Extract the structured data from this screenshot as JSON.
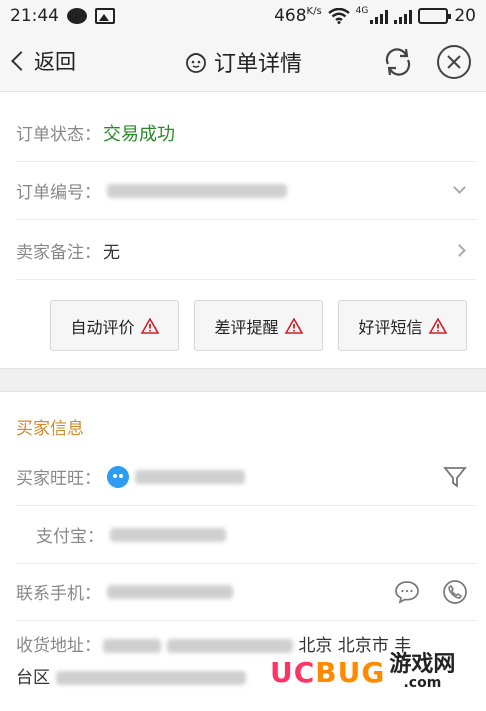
{
  "status_bar": {
    "time": "21:44",
    "speed": "468",
    "speed_unit": "K/s",
    "network": "4G",
    "battery": "20"
  },
  "header": {
    "back_label": "返回",
    "title": "订单详情"
  },
  "order": {
    "status_label": "订单状态：",
    "status_value": "交易成功",
    "number_label": "订单编号：",
    "note_label": "卖家备注：",
    "note_value": "无"
  },
  "actions": [
    {
      "label": "自动评价"
    },
    {
      "label": "差评提醒"
    },
    {
      "label": "好评短信"
    }
  ],
  "buyer": {
    "section_title": "买家信息",
    "wangwang_label": "买家旺旺：",
    "alipay_label": "支付宝：",
    "phone_label": "联系手机：",
    "address_label": "收货地址：",
    "address_visible": "北京 北京市 丰",
    "address_line2": "台区"
  },
  "watermark": {
    "logo_a": "UC",
    "logo_b": "BUG",
    "cn": "游戏网",
    "com": ".com"
  },
  "colors": {
    "success": "#2a8a2a",
    "section_title": "#d08a2a",
    "warning": "#d0202a",
    "wangwang": "#2d9df2"
  }
}
